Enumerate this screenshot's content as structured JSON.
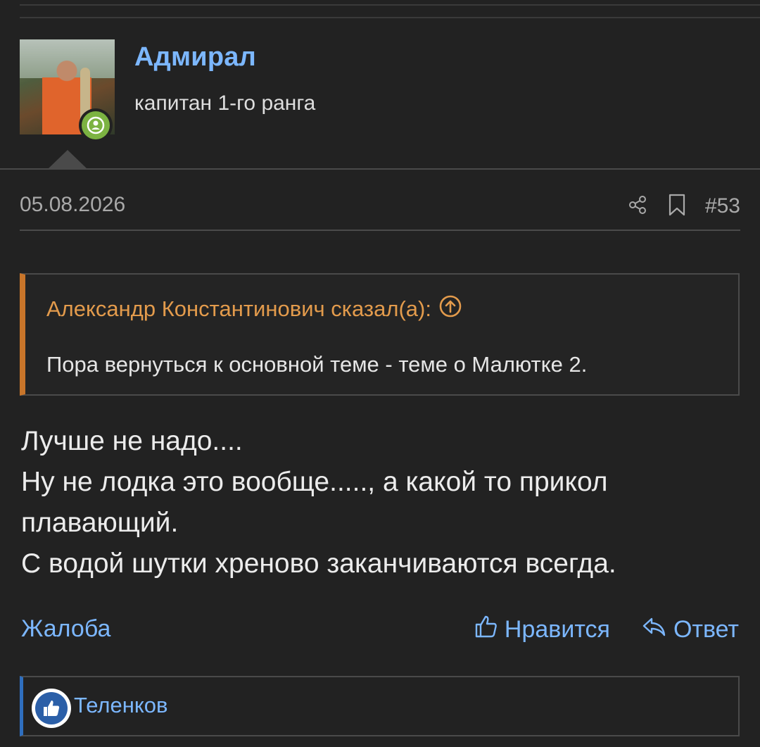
{
  "author": {
    "name": "Адмирал",
    "rank": "капитан 1-го ранга",
    "status_color": "#7cb342"
  },
  "meta": {
    "date": "05.08.2026",
    "post_number": "#53",
    "share_icon": "share-icon",
    "bookmark_icon": "bookmark-icon"
  },
  "quote": {
    "author_line": "Александр Константинович сказал(а):",
    "jump_icon": "arrow-up-circle-icon",
    "text": "Пора вернуться к основной теме - теме о Малютке 2.",
    "accent_color": "#c8752a"
  },
  "body": {
    "lines": [
      "Лучше не надо....",
      "Ну не лодка это вообще....., а какой то прикол",
      "плавающий.",
      "С водой шутки хреново заканчиваются всегда."
    ]
  },
  "footer": {
    "report_label": "Жалоба",
    "like_label": "Нравится",
    "reply_label": "Ответ",
    "link_color": "#7cb7ff"
  },
  "reactions": {
    "icon": "thumbs-up-icon",
    "users": "Теленков"
  }
}
